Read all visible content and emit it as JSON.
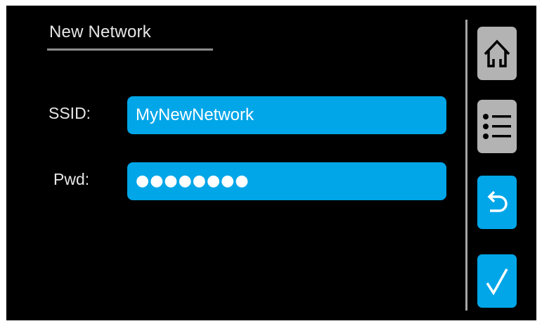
{
  "header": {
    "title": "New Network"
  },
  "form": {
    "ssid_label": "SSID:",
    "ssid_value": "MyNewNetwork",
    "pwd_label": "Pwd:",
    "pwd_value": "●●●●●●●●"
  },
  "sidebar": {
    "buttons": [
      {
        "icon": "home-icon",
        "style": "gray"
      },
      {
        "icon": "menu-list-icon",
        "style": "gray"
      },
      {
        "icon": "back-arrow-icon",
        "style": "blue"
      },
      {
        "icon": "checkmark-icon",
        "style": "blue"
      }
    ]
  },
  "colors": {
    "background": "#000000",
    "accent": "#00a6e8",
    "button_gray": "#b3b3b3",
    "text": "#e6e6e6"
  }
}
